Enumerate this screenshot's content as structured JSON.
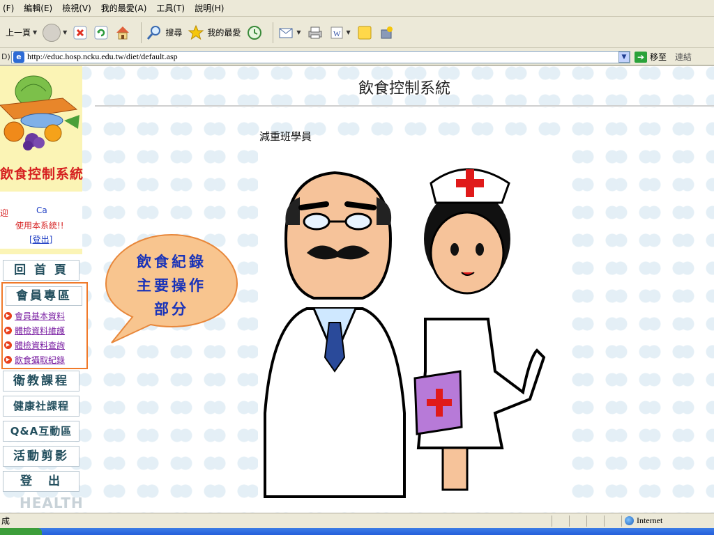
{
  "menu": [
    "(F)",
    "編輯(E)",
    "檢視(V)",
    "我的最愛(A)",
    "工具(T)",
    "說明(H)"
  ],
  "toolbar": {
    "back_label": "上一頁",
    "search_label": "搜尋",
    "favorites_label": "我的最愛"
  },
  "address": {
    "label": "D)",
    "url": "http://educ.hosp.ncku.edu.tw/diet/default.asp",
    "go_label": "移至",
    "links_label": "連結"
  },
  "sidebar": {
    "system_logo": "飲食控制系統",
    "user_partial": "迎",
    "user_name": "Ca",
    "welcome": "使用本系統!!",
    "logout": "[登出]",
    "nav_home": "回 首 頁",
    "member_zone": "會員專區",
    "member_links": [
      "會員基本資料",
      "體檢資料維護",
      "體檢資料查詢",
      "飲食攝取紀錄"
    ],
    "nav_items": [
      "衛教課程",
      "健康社課程",
      "Q&A互動區",
      "活動剪影",
      "登　出"
    ],
    "health_text": "HEALTH"
  },
  "main": {
    "title": "飲食控制系統",
    "subtitle": "減重班學員"
  },
  "callout": {
    "lines": [
      "飲食紀錄",
      "主要操作",
      "部分"
    ],
    "color": "#1a33b8",
    "fill": "#f8c58f",
    "border": "#e8873a"
  },
  "status": {
    "text": "成",
    "zone": "Internet"
  }
}
